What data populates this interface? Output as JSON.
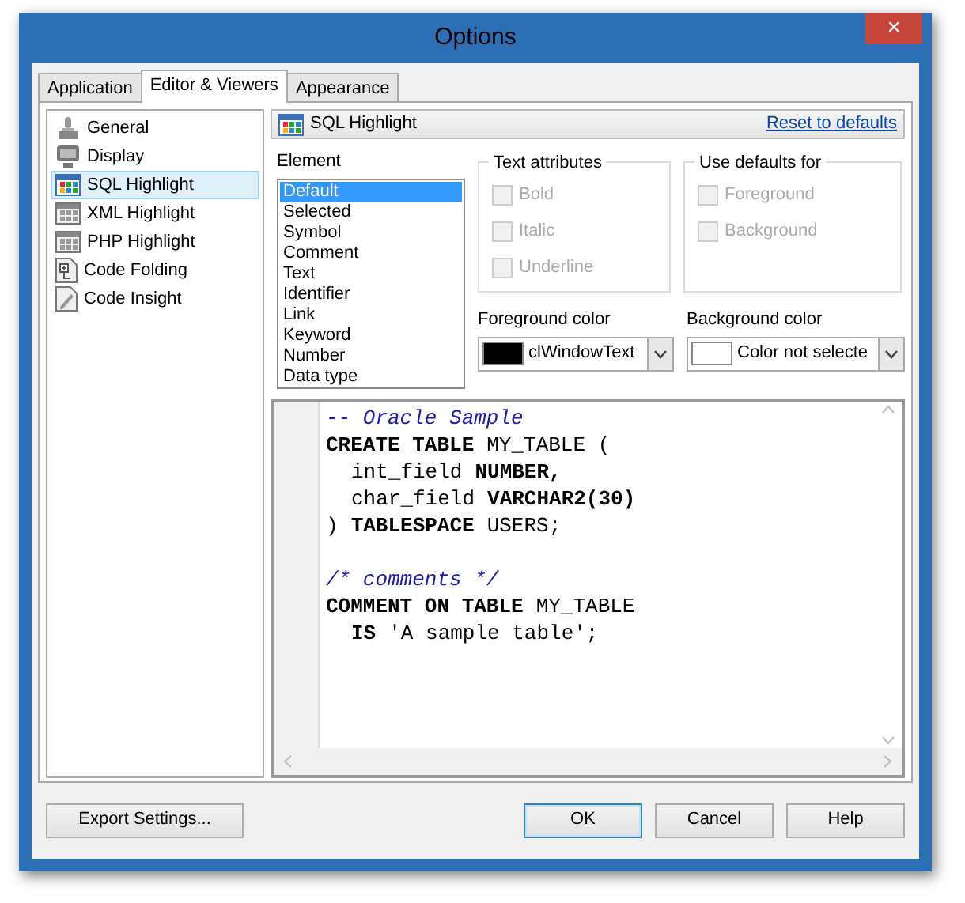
{
  "window": {
    "title": "Options",
    "close": "✕"
  },
  "tabs": [
    {
      "label": "Application",
      "selected": false
    },
    {
      "label": "Editor & Viewers",
      "selected": true
    },
    {
      "label": "Appearance",
      "selected": false
    }
  ],
  "sidebar": {
    "items": [
      {
        "label": "General",
        "kind": "general",
        "selected": false
      },
      {
        "label": "Display",
        "kind": "display",
        "selected": false
      },
      {
        "label": "SQL Highlight",
        "kind": "grid-color",
        "selected": true
      },
      {
        "label": "XML Highlight",
        "kind": "grid",
        "selected": false
      },
      {
        "label": "PHP Highlight",
        "kind": "grid",
        "selected": false
      },
      {
        "label": "Code Folding",
        "kind": "folding",
        "selected": false
      },
      {
        "label": "Code Insight",
        "kind": "insight",
        "selected": false
      }
    ]
  },
  "panel": {
    "title": "SQL Highlight",
    "reset_link": "Reset to defaults",
    "element_label": "Element",
    "elements": [
      {
        "label": "Default",
        "selected": true
      },
      {
        "label": "Selected",
        "selected": false
      },
      {
        "label": "Symbol",
        "selected": false
      },
      {
        "label": "Comment",
        "selected": false
      },
      {
        "label": "Text",
        "selected": false
      },
      {
        "label": "Identifier",
        "selected": false
      },
      {
        "label": "Link",
        "selected": false
      },
      {
        "label": "Keyword",
        "selected": false
      },
      {
        "label": "Number",
        "selected": false
      },
      {
        "label": "Data type",
        "selected": false
      }
    ],
    "text_attributes": {
      "title": "Text attributes",
      "options": [
        {
          "label": "Bold",
          "checked": false,
          "disabled": true
        },
        {
          "label": "Italic",
          "checked": false,
          "disabled": true
        },
        {
          "label": "Underline",
          "checked": false,
          "disabled": true
        }
      ]
    },
    "use_defaults": {
      "title": "Use defaults for",
      "options": [
        {
          "label": "Foreground",
          "checked": false,
          "disabled": true
        },
        {
          "label": "Background",
          "checked": false,
          "disabled": true
        }
      ]
    },
    "foreground": {
      "label": "Foreground color",
      "value": "clWindowText",
      "color": "#000000"
    },
    "background": {
      "label": "Background color",
      "value": "Color not selecte",
      "color": "#ffffff"
    },
    "code": [
      {
        "gap_before": false,
        "parts": [
          {
            "text": "-- Oracle Sample",
            "kind": "comment"
          }
        ]
      },
      {
        "gap_before": false,
        "parts": [
          {
            "text": "CREATE TABLE",
            "kind": "keyword"
          },
          {
            "text": "MY_TABLE (",
            "kind": "plain"
          }
        ]
      },
      {
        "gap_before": false,
        "parts": [
          {
            "text": "int_field",
            "kind": "plain"
          },
          {
            "text": "NUMBER,",
            "kind": "keyword"
          }
        ]
      },
      {
        "gap_before": false,
        "parts": [
          {
            "text": "char_field",
            "kind": "plain"
          },
          {
            "text": "VARCHAR2(30)",
            "kind": "keyword"
          }
        ]
      },
      {
        "gap_before": false,
        "parts": [
          {
            "text": ")",
            "kind": "plain"
          },
          {
            "text": "TABLESPACE",
            "kind": "keyword"
          },
          {
            "text": "USERS;",
            "kind": "plain"
          }
        ]
      },
      {
        "gap_before": true,
        "parts": [
          {
            "text": "/* comments */",
            "kind": "comment"
          }
        ]
      },
      {
        "gap_before": false,
        "parts": [
          {
            "text": "COMMENT ON TABLE",
            "kind": "keyword"
          },
          {
            "text": "MY_TABLE",
            "kind": "plain"
          }
        ]
      },
      {
        "gap_before": false,
        "parts": [
          {
            "text": "IS",
            "kind": "keyword"
          },
          {
            "text": "'A sample table';",
            "kind": "plain"
          }
        ]
      }
    ]
  },
  "buttons": [
    {
      "label": "Export Settings...",
      "kind": "left",
      "default": false
    },
    {
      "label": "OK",
      "kind": "right",
      "default": true
    },
    {
      "label": "Cancel",
      "kind": "right",
      "default": false
    },
    {
      "label": "Help",
      "kind": "right",
      "default": false
    }
  ]
}
